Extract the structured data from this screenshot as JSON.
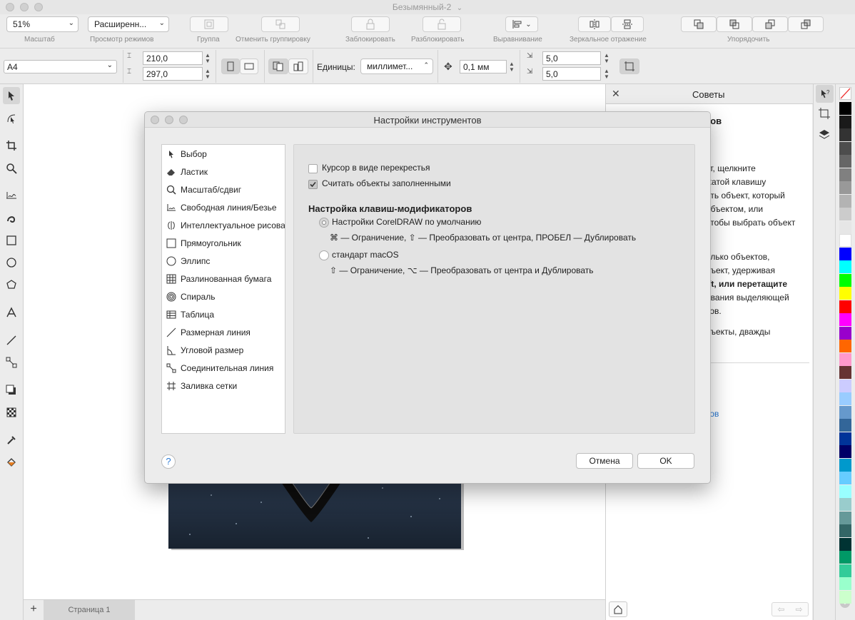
{
  "window": {
    "title": "Безымянный-2"
  },
  "toolbar": {
    "zoom_value": "51%",
    "zoom_label": "Масштаб",
    "view_mode_value": "Расширенн...",
    "view_mode_label": "Просмотр режимов",
    "group_label": "Группа",
    "ungroup_label": "Отменить группировку",
    "lock_label": "Заблокировать",
    "unlock_label": "Разблокировать",
    "align_label": "Выравнивание",
    "mirror_label": "Зеркальное отражение",
    "arrange_label": "Упорядочить"
  },
  "propbar": {
    "page_size": "A4",
    "width": "210,0",
    "height": "297,0",
    "units_label": "Единицы:",
    "units_value": "миллимет...",
    "nudge_value": "0,1 мм",
    "dup_x": "5,0",
    "dup_y": "5,0"
  },
  "bottom": {
    "page_tab": "Страница 1"
  },
  "tips": {
    "title": "Советы",
    "lines": [
      "тов",
      "кт, щелкните",
      "жатой клавишу",
      "ать объект, который",
      "объектом, или",
      "чтобы выбрать объект",
      "олько объектов,",
      "бъект, удерживая",
      "ift, или перетащите",
      "ования выделяющей",
      "тов.",
      "бъекты, дважды",
      ".",
      "тов"
    ]
  },
  "dialog": {
    "title": "Настройки инструментов",
    "tools": [
      {
        "label": "Выбор",
        "icon": "pointer-icon"
      },
      {
        "label": "Ластик",
        "icon": "eraser-icon"
      },
      {
        "label": "Масштаб/сдвиг",
        "icon": "magnifier-icon"
      },
      {
        "label": "Свободная линия/Безье",
        "icon": "freehand-icon"
      },
      {
        "label": "Интеллектуальное рисование",
        "icon": "smart-draw-icon"
      },
      {
        "label": "Прямоугольник",
        "icon": "rectangle-icon"
      },
      {
        "label": "Эллипс",
        "icon": "ellipse-icon"
      },
      {
        "label": "Разлинованная бумага",
        "icon": "graph-paper-icon"
      },
      {
        "label": "Спираль",
        "icon": "spiral-icon"
      },
      {
        "label": "Таблица",
        "icon": "table-icon"
      },
      {
        "label": "Размерная линия",
        "icon": "dimension-line-icon"
      },
      {
        "label": "Угловой размер",
        "icon": "angular-dimension-icon"
      },
      {
        "label": "Соединительная линия",
        "icon": "connector-icon"
      },
      {
        "label": "Заливка сетки",
        "icon": "mesh-fill-icon"
      }
    ],
    "crosshair_label": "Курсор в виде перекрестья",
    "crosshair_checked": false,
    "filled_label": "Считать объекты заполненными",
    "filled_checked": true,
    "modifiers_heading": "Настройка клавиш-модификаторов",
    "option_default_label": "Настройки CorelDRAW по умолчанию",
    "option_default_desc": "⌘ — Ограничение, ⇧ — Преобразовать от центра, ПРОБЕЛ — Дублировать",
    "option_macos_label": "стандарт macOS",
    "option_macos_desc": "⇧ — Ограничение, ⌥ — Преобразовать от центра и Дублировать",
    "selected_option": "default",
    "help_label": "?",
    "cancel_label": "Отмена",
    "ok_label": "OK"
  },
  "palette_colors": [
    "#000000",
    "#1a1a1a",
    "#333333",
    "#4d4d4d",
    "#666666",
    "#808080",
    "#999999",
    "#b3b3b3",
    "#cccccc",
    "#e6e6e6",
    "#ffffff",
    "#0000ff",
    "#00ffff",
    "#00ff00",
    "#ffff00",
    "#ff0000",
    "#ff00ff",
    "#9900cc",
    "#ff6600",
    "#ff99cc",
    "#663333",
    "#ccccff",
    "#99ccff",
    "#6699cc",
    "#336699",
    "#003399",
    "#000066",
    "#0099cc",
    "#66ccff",
    "#99ffff",
    "#99cccc",
    "#669999",
    "#336666",
    "#003333",
    "#009966",
    "#33cc99",
    "#99ffcc",
    "#ccffcc"
  ]
}
